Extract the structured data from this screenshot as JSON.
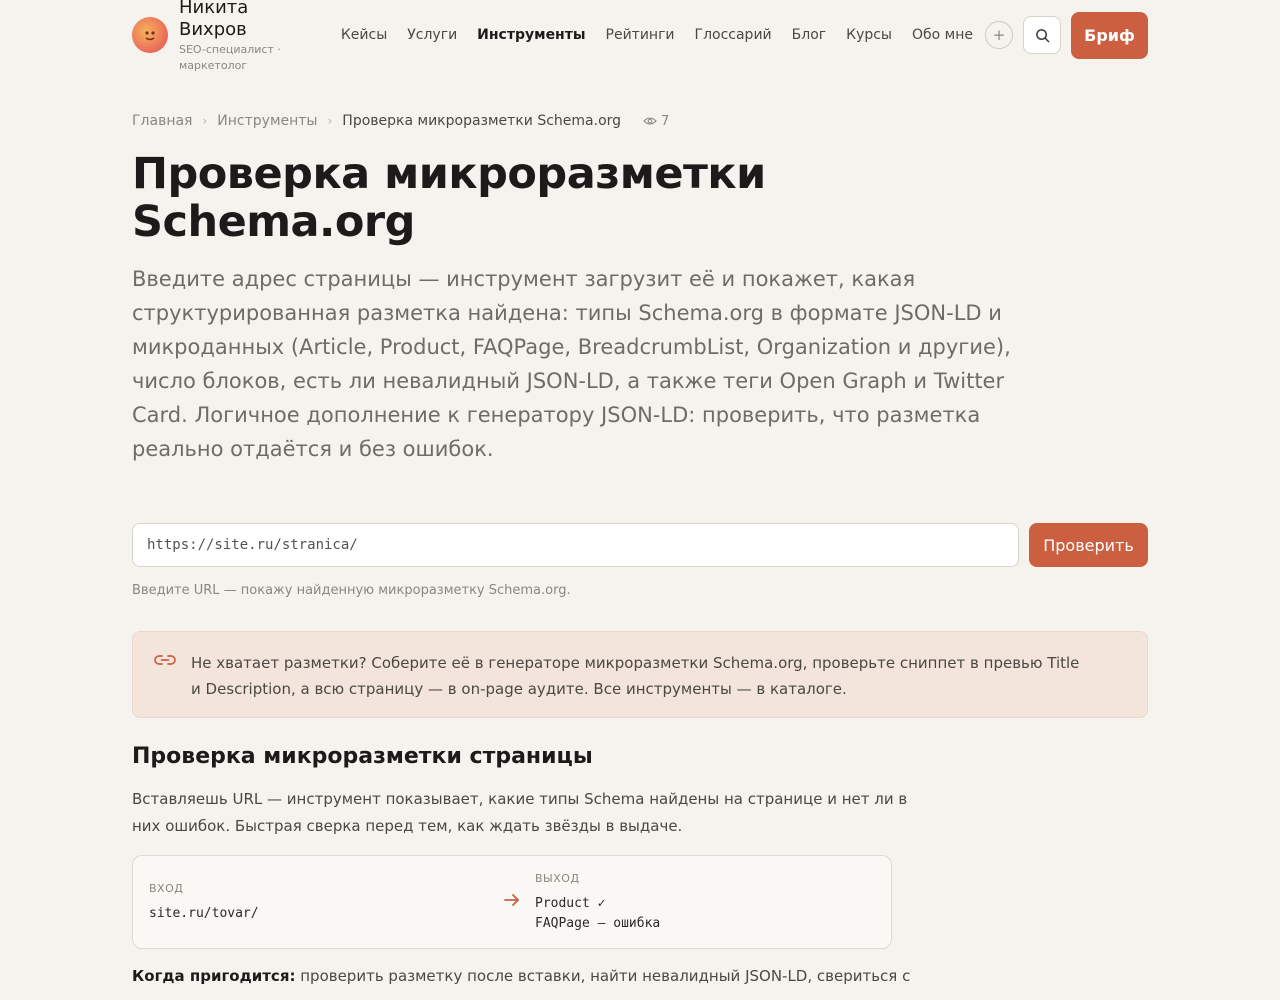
{
  "header": {
    "brand_name": "Никита Вихров",
    "brand_sub": "SEO-специалист · маркетолог",
    "nav": [
      "Кейсы",
      "Услуги",
      "Инструменты",
      "Рейтинги",
      "Глоссарий",
      "Блог",
      "Курсы",
      "Обо мне"
    ],
    "active_nav": "Инструменты",
    "plus_label": "+",
    "brief_label": "Бриф"
  },
  "breadcrumb": {
    "home": "Главная",
    "section": "Инструменты",
    "current": "Проверка микроразметки Schema.org",
    "views": "7"
  },
  "page_title": "Проверка микроразметки Schema.org",
  "lead": "Введите адрес страницы — инструмент загрузит её и покажет, какая структурированная разметка найдена: типы Schema.org в формате JSON-LD и микроданных (Article, Product, FAQPage, BreadcrumbList, Organization и другие), число блоков, есть ли невалидный JSON-LD, а также теги Open Graph и Twitter Card. Логичное дополнение к генератору JSON-LD: проверить, что разметка реально отдаётся и без ошибок.",
  "form": {
    "placeholder": "https://site.ru/stranica/",
    "value": "",
    "submit_label": "Проверить",
    "hint": "Введите URL — покажу найденную микроразметку Schema.org."
  },
  "callout": {
    "text": "Не хватает разметки? Соберите её в генераторе микроразметки Schema.org, проверьте сниппет в превью Title и Description, а всю страницу — в on-page аудите. Все инструменты — в каталоге."
  },
  "section": {
    "title": "Проверка микроразметки страницы",
    "text": "Вставляешь URL — инструмент показывает, какие типы Schema найдены на странице и нет ли в них ошибок. Быстрая сверка перед тем, как ждать звёзды в выдаче."
  },
  "example": {
    "input_label": "ВХОД",
    "input_value": "site.ru/tovar/",
    "output_label": "ВЫХОД",
    "output_line1": "Product ✓",
    "output_line2": "FAQPage — ошибка"
  },
  "usage": {
    "label": "Когда пригодится:",
    "text": " проверить разметку после вставки, найти невалидный JSON-LD, свериться с конкурентом."
  },
  "colors": {
    "accent": "#cc5f3f",
    "background": "#f5f3ee",
    "callout_bg": "#f3e5dc"
  }
}
